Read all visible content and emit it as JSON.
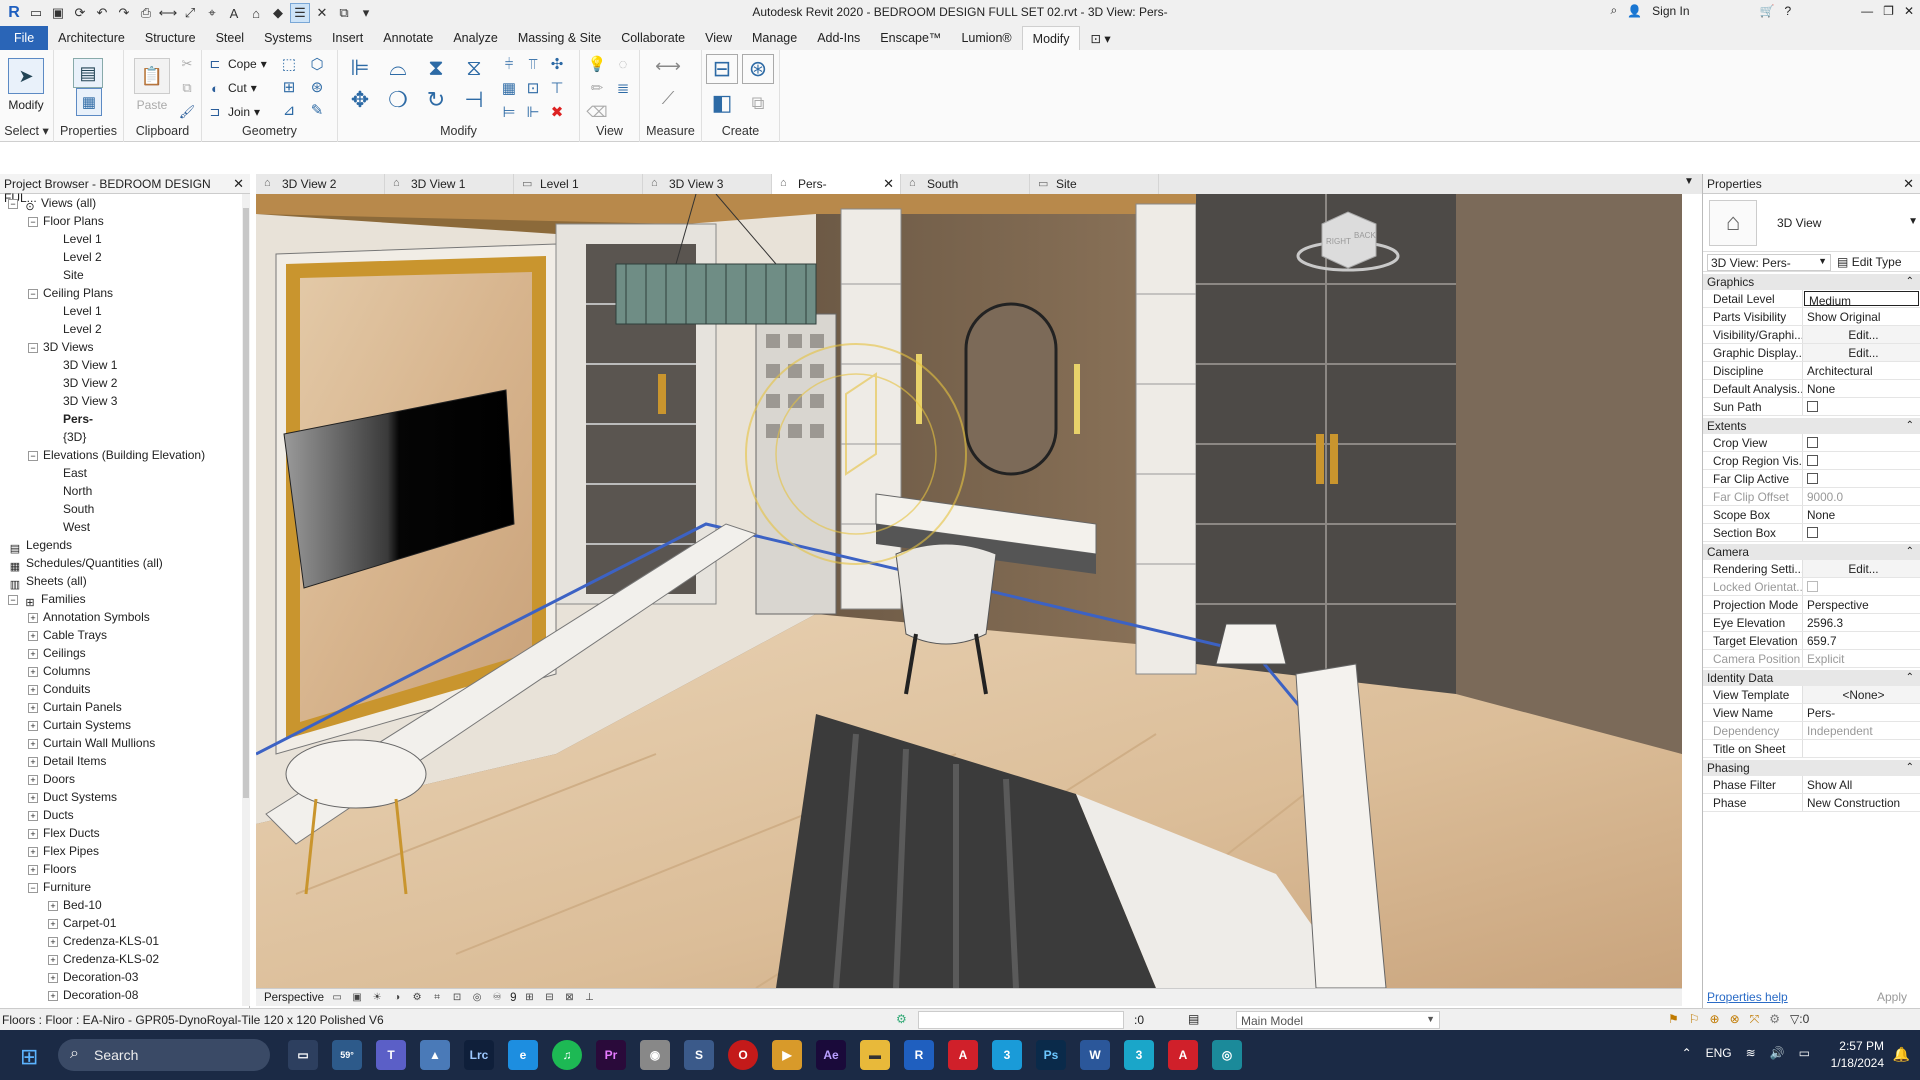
{
  "app": {
    "title": "Autodesk Revit 2020 - BEDROOM DESIGN FULL SET 02.rvt - 3D View: Pers-",
    "sign_in": "Sign In"
  },
  "ribbon_tabs": [
    "File",
    "Architecture",
    "Structure",
    "Steel",
    "Systems",
    "Insert",
    "Annotate",
    "Analyze",
    "Massing & Site",
    "Collaborate",
    "View",
    "Manage",
    "Add-Ins",
    "Enscape™",
    "Lumion®",
    "Modify"
  ],
  "ribbon": {
    "select_label": "Select",
    "modify_label": "Modify",
    "properties_label": "Properties",
    "paste_label": "Paste",
    "clipboard_label": "Clipboard",
    "cope_label": "Cope",
    "cut_label": "Cut",
    "join_label": "Join",
    "geometry_label": "Geometry",
    "modify_panel_label": "Modify",
    "view_label": "View",
    "measure_label": "Measure",
    "create_label": "Create"
  },
  "project_browser": {
    "title": "Project Browser - BEDROOM DESIGN FUL...",
    "nodes": [
      {
        "label": "Views (all)",
        "level": 0,
        "tog": "−",
        "icon": "views"
      },
      {
        "label": "Floor Plans",
        "level": 1,
        "tog": "−"
      },
      {
        "label": "Level 1",
        "level": 2
      },
      {
        "label": "Level 2",
        "level": 2
      },
      {
        "label": "Site",
        "level": 2
      },
      {
        "label": "Ceiling Plans",
        "level": 1,
        "tog": "−"
      },
      {
        "label": "Level 1",
        "level": 2
      },
      {
        "label": "Level 2",
        "level": 2
      },
      {
        "label": "3D Views",
        "level": 1,
        "tog": "−"
      },
      {
        "label": "3D View 1",
        "level": 2
      },
      {
        "label": "3D View 2",
        "level": 2
      },
      {
        "label": "3D View 3",
        "level": 2
      },
      {
        "label": "Pers-",
        "level": 2,
        "bold": true
      },
      {
        "label": "{3D}",
        "level": 2
      },
      {
        "label": "Elevations (Building Elevation)",
        "level": 1,
        "tog": "−"
      },
      {
        "label": "East",
        "level": 2
      },
      {
        "label": "North",
        "level": 2
      },
      {
        "label": "South",
        "level": 2
      },
      {
        "label": "West",
        "level": 2
      },
      {
        "label": "Legends",
        "level": 0,
        "icon": "legend"
      },
      {
        "label": "Schedules/Quantities (all)",
        "level": 0,
        "icon": "sched"
      },
      {
        "label": "Sheets (all)",
        "level": 0,
        "icon": "sheet"
      },
      {
        "label": "Families",
        "level": 0,
        "tog": "−",
        "icon": "fam"
      },
      {
        "label": "Annotation Symbols",
        "level": 1,
        "tog": "+"
      },
      {
        "label": "Cable Trays",
        "level": 1,
        "tog": "+"
      },
      {
        "label": "Ceilings",
        "level": 1,
        "tog": "+"
      },
      {
        "label": "Columns",
        "level": 1,
        "tog": "+"
      },
      {
        "label": "Conduits",
        "level": 1,
        "tog": "+"
      },
      {
        "label": "Curtain Panels",
        "level": 1,
        "tog": "+"
      },
      {
        "label": "Curtain Systems",
        "level": 1,
        "tog": "+"
      },
      {
        "label": "Curtain Wall Mullions",
        "level": 1,
        "tog": "+"
      },
      {
        "label": "Detail Items",
        "level": 1,
        "tog": "+"
      },
      {
        "label": "Doors",
        "level": 1,
        "tog": "+"
      },
      {
        "label": "Duct Systems",
        "level": 1,
        "tog": "+"
      },
      {
        "label": "Ducts",
        "level": 1,
        "tog": "+"
      },
      {
        "label": "Flex Ducts",
        "level": 1,
        "tog": "+"
      },
      {
        "label": "Flex Pipes",
        "level": 1,
        "tog": "+"
      },
      {
        "label": "Floors",
        "level": 1,
        "tog": "+"
      },
      {
        "label": "Furniture",
        "level": 1,
        "tog": "−"
      },
      {
        "label": "Bed-10",
        "level": 2,
        "tog": "+"
      },
      {
        "label": "Carpet-01",
        "level": 2,
        "tog": "+"
      },
      {
        "label": "Credenza-KLS-01",
        "level": 2,
        "tog": "+"
      },
      {
        "label": "Credenza-KLS-02",
        "level": 2,
        "tog": "+"
      },
      {
        "label": "Decoration-03",
        "level": 2,
        "tog": "+"
      },
      {
        "label": "Decoration-08",
        "level": 2,
        "tog": "+"
      }
    ]
  },
  "view_tabs": [
    {
      "label": "3D View 2",
      "icon": "cube"
    },
    {
      "label": "3D View 1",
      "icon": "cube"
    },
    {
      "label": "Level 1",
      "icon": "plan"
    },
    {
      "label": "3D View 3",
      "icon": "cube"
    },
    {
      "label": "Pers-",
      "icon": "cube",
      "active": true
    },
    {
      "label": "South",
      "icon": "elev"
    },
    {
      "label": "Site",
      "icon": "plan"
    }
  ],
  "viewport": {
    "view_label": "Perspective",
    "viewcube_right": "RIGHT",
    "viewcube_back": "BACK",
    "bar_value": "9"
  },
  "properties": {
    "title": "Properties",
    "type_name": "3D View",
    "view_selector": "3D View: Pers-",
    "edit_type": "Edit Type",
    "groups": [
      {
        "name": "Graphics",
        "rows": [
          {
            "k": "Detail Level",
            "v": "Medium",
            "style": "box"
          },
          {
            "k": "Parts Visibility",
            "v": "Show Original"
          },
          {
            "k": "Visibility/Graphi...",
            "v": "Edit...",
            "style": "btn"
          },
          {
            "k": "Graphic Display...",
            "v": "Edit...",
            "style": "btn"
          },
          {
            "k": "Discipline",
            "v": "Architectural"
          },
          {
            "k": "Default Analysis...",
            "v": "None"
          },
          {
            "k": "Sun Path",
            "v": "",
            "style": "cb"
          }
        ]
      },
      {
        "name": "Extents",
        "rows": [
          {
            "k": "Crop View",
            "v": "",
            "style": "cb"
          },
          {
            "k": "Crop Region Vis...",
            "v": "",
            "style": "cb"
          },
          {
            "k": "Far Clip Active",
            "v": "",
            "style": "cb"
          },
          {
            "k": "Far Clip Offset",
            "v": "9000.0",
            "style": "dim"
          },
          {
            "k": "Scope Box",
            "v": "None"
          },
          {
            "k": "Section Box",
            "v": "",
            "style": "cb"
          }
        ]
      },
      {
        "name": "Camera",
        "rows": [
          {
            "k": "Rendering Setti...",
            "v": "Edit...",
            "style": "btn"
          },
          {
            "k": "Locked Orientat...",
            "v": "",
            "style": "dimcb"
          },
          {
            "k": "Projection Mode",
            "v": "Perspective"
          },
          {
            "k": "Eye Elevation",
            "v": "2596.3"
          },
          {
            "k": "Target Elevation",
            "v": "659.7"
          },
          {
            "k": "Camera Position",
            "v": "Explicit",
            "style": "dim"
          }
        ]
      },
      {
        "name": "Identity Data",
        "rows": [
          {
            "k": "View Template",
            "v": "<None>",
            "style": "btn"
          },
          {
            "k": "View Name",
            "v": "Pers-"
          },
          {
            "k": "Dependency",
            "v": "Independent",
            "style": "dim"
          },
          {
            "k": "Title on Sheet",
            "v": ""
          }
        ]
      },
      {
        "name": "Phasing",
        "rows": [
          {
            "k": "Phase Filter",
            "v": "Show All"
          },
          {
            "k": "Phase",
            "v": "New Construction"
          }
        ]
      }
    ],
    "help": "Properties help",
    "apply": "Apply"
  },
  "status": {
    "text": "Floors : Floor : EA-Niro - GPR05-DynoRoyal-Tile 120 x 120 Polished V6",
    "coord": ":0",
    "workset": "Main Model",
    "filter": ":0"
  },
  "taskbar": {
    "search": "Search",
    "weather": "59°",
    "lang": "ENG",
    "time": "2:57 PM",
    "date": "1/18/2024"
  },
  "colors": {
    "file_tab": "#2a65b7",
    "taskbar": "#1b2a45",
    "gold": "#c9952e"
  }
}
